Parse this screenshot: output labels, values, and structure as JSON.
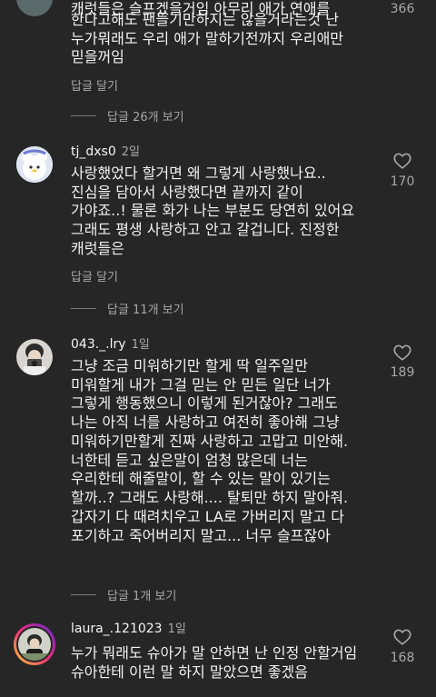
{
  "top_comment": {
    "lines": [
      "캐럿들은 슬프겠을거임 아무리 애가 연애를",
      "한다고해도 팬들기만하지는 않을거라는것 난",
      "누가뭐래도 우리 애가 말하기전까지 우리애만",
      "믿을꺼임"
    ],
    "likes": "366",
    "reply_label": "답글 달기",
    "view_replies": "답글 26개 보기"
  },
  "comments": [
    {
      "username": "tj_dxs0",
      "age": "2일",
      "lines": [
        "사랑했었다 할거면 왜 그렇게 사랑했나요..",
        "진심을 담아서 사랑했다면 끝까지 같이",
        "가야죠..! 물론 화가 나는 부분도 당연히 있어요",
        "그래도 평생 사랑하고 안고 갈겁니다. 진정한",
        "캐럿들은"
      ],
      "likes": "170",
      "reply_label": "답글 달기",
      "view_replies": "답글 11개 보기"
    },
    {
      "username": "043._.lry",
      "age": "1일",
      "lines": [
        "그냥 조금 미워하기만 할게 딱 일주일만",
        "미워할게 내가 그걸 믿는 안 믿든 일단 너가",
        "그렇게 행동했으니 이렇게 된거잖아? 그래도",
        "나는 아직 너를 사랑하고 여전히 좋아해 그냥",
        "미워하기만할게 진짜 사랑하고 고맙고 미안해.",
        "너한테 듣고 싶은말이 엄청 많은데 너는",
        "우리한테 해줄말이, 할 수 있는 말이 있기는",
        "할까..? 그래도 사랑해.... 탈퇴만 하지 말아줘.",
        "갑자기 다 때려치우고 LA로 가버리지 말고 다",
        "포기하고 죽어버리지 말고... 너무 슬프잖아"
      ],
      "likes": "189",
      "view_replies": "답글 1개 보기"
    },
    {
      "username": "laura_.121023",
      "age": "1일",
      "lines": [
        "누가 뭐래도 슈아가 말 안하면 난 인정 안할거임",
        "슈아한테 이런 말 하지 말았으면 좋겠음"
      ],
      "likes": "168"
    }
  ],
  "icons": {
    "like": "heart-outline-icon"
  },
  "colors": {
    "background": "#262626",
    "text": "#f5f5f5",
    "secondary_text": "#a8a8a8",
    "story_ring": "#d6249f"
  }
}
